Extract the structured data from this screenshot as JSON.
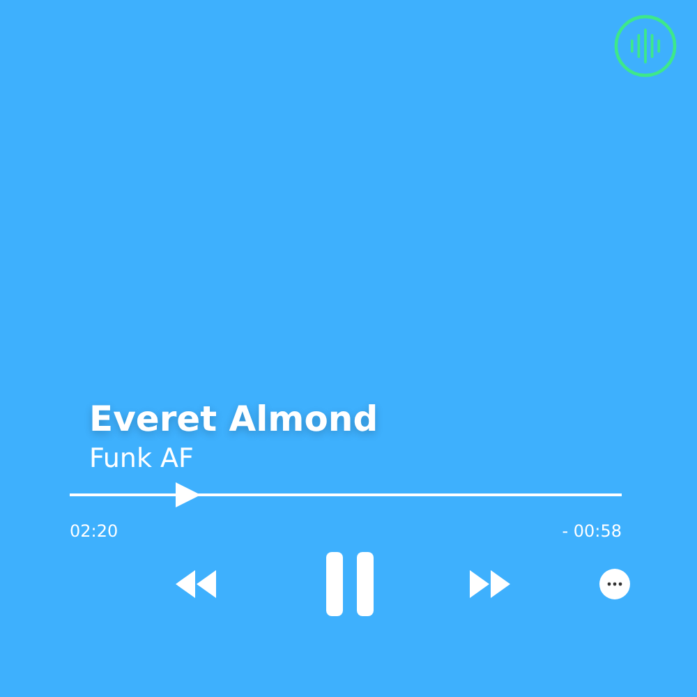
{
  "track": {
    "title": "Everet Almond",
    "artist": "Funk AF"
  },
  "progress": {
    "level": 0.21,
    "elapsed": "02:20",
    "remaining": "- 00:58"
  },
  "playback": {
    "playing": true
  }
}
